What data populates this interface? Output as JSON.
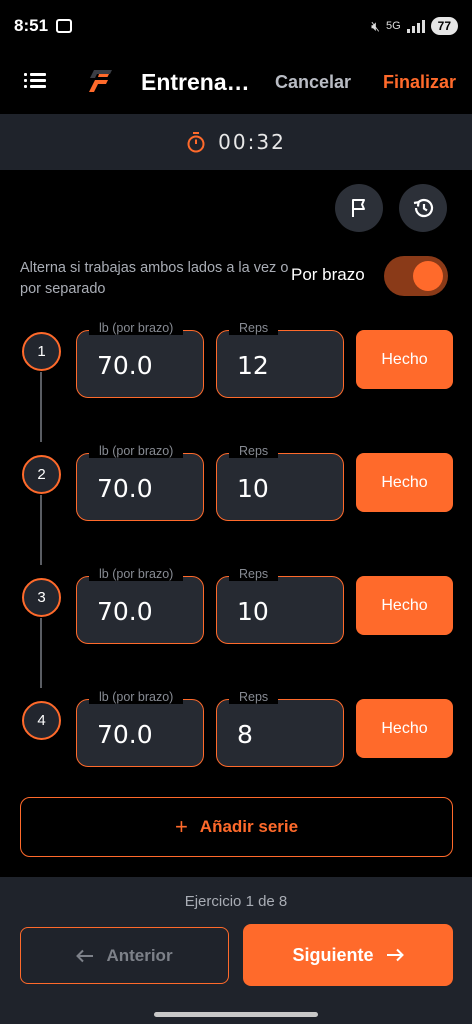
{
  "status_bar": {
    "time": "8:51",
    "network": "5G",
    "battery": "77"
  },
  "header": {
    "title": "Entrenamiento",
    "cancel_label": "Cancelar",
    "finish_label": "Finalizar"
  },
  "timer": {
    "elapsed": "00:32"
  },
  "options": {
    "hint": "Alterna si trabajas ambos lados a la vez o por separado",
    "toggle_label": "Por brazo",
    "toggle_on": true
  },
  "weight_label": "lb (por brazo)",
  "reps_label": "Reps",
  "done_label": "Hecho",
  "sets": [
    {
      "number": "1",
      "weight": "70.0",
      "reps": "12"
    },
    {
      "number": "2",
      "weight": "70.0",
      "reps": "10"
    },
    {
      "number": "3",
      "weight": "70.0",
      "reps": "10"
    },
    {
      "number": "4",
      "weight": "70.0",
      "reps": "8"
    }
  ],
  "add_set_label": "Añadir serie",
  "footer": {
    "progress": "Ejercicio 1 de 8",
    "prev_label": "Anterior",
    "next_label": "Siguiente"
  },
  "colors": {
    "accent": "#ff6a2b",
    "panel": "#1f232b",
    "field": "#262a32",
    "background": "#000000"
  }
}
